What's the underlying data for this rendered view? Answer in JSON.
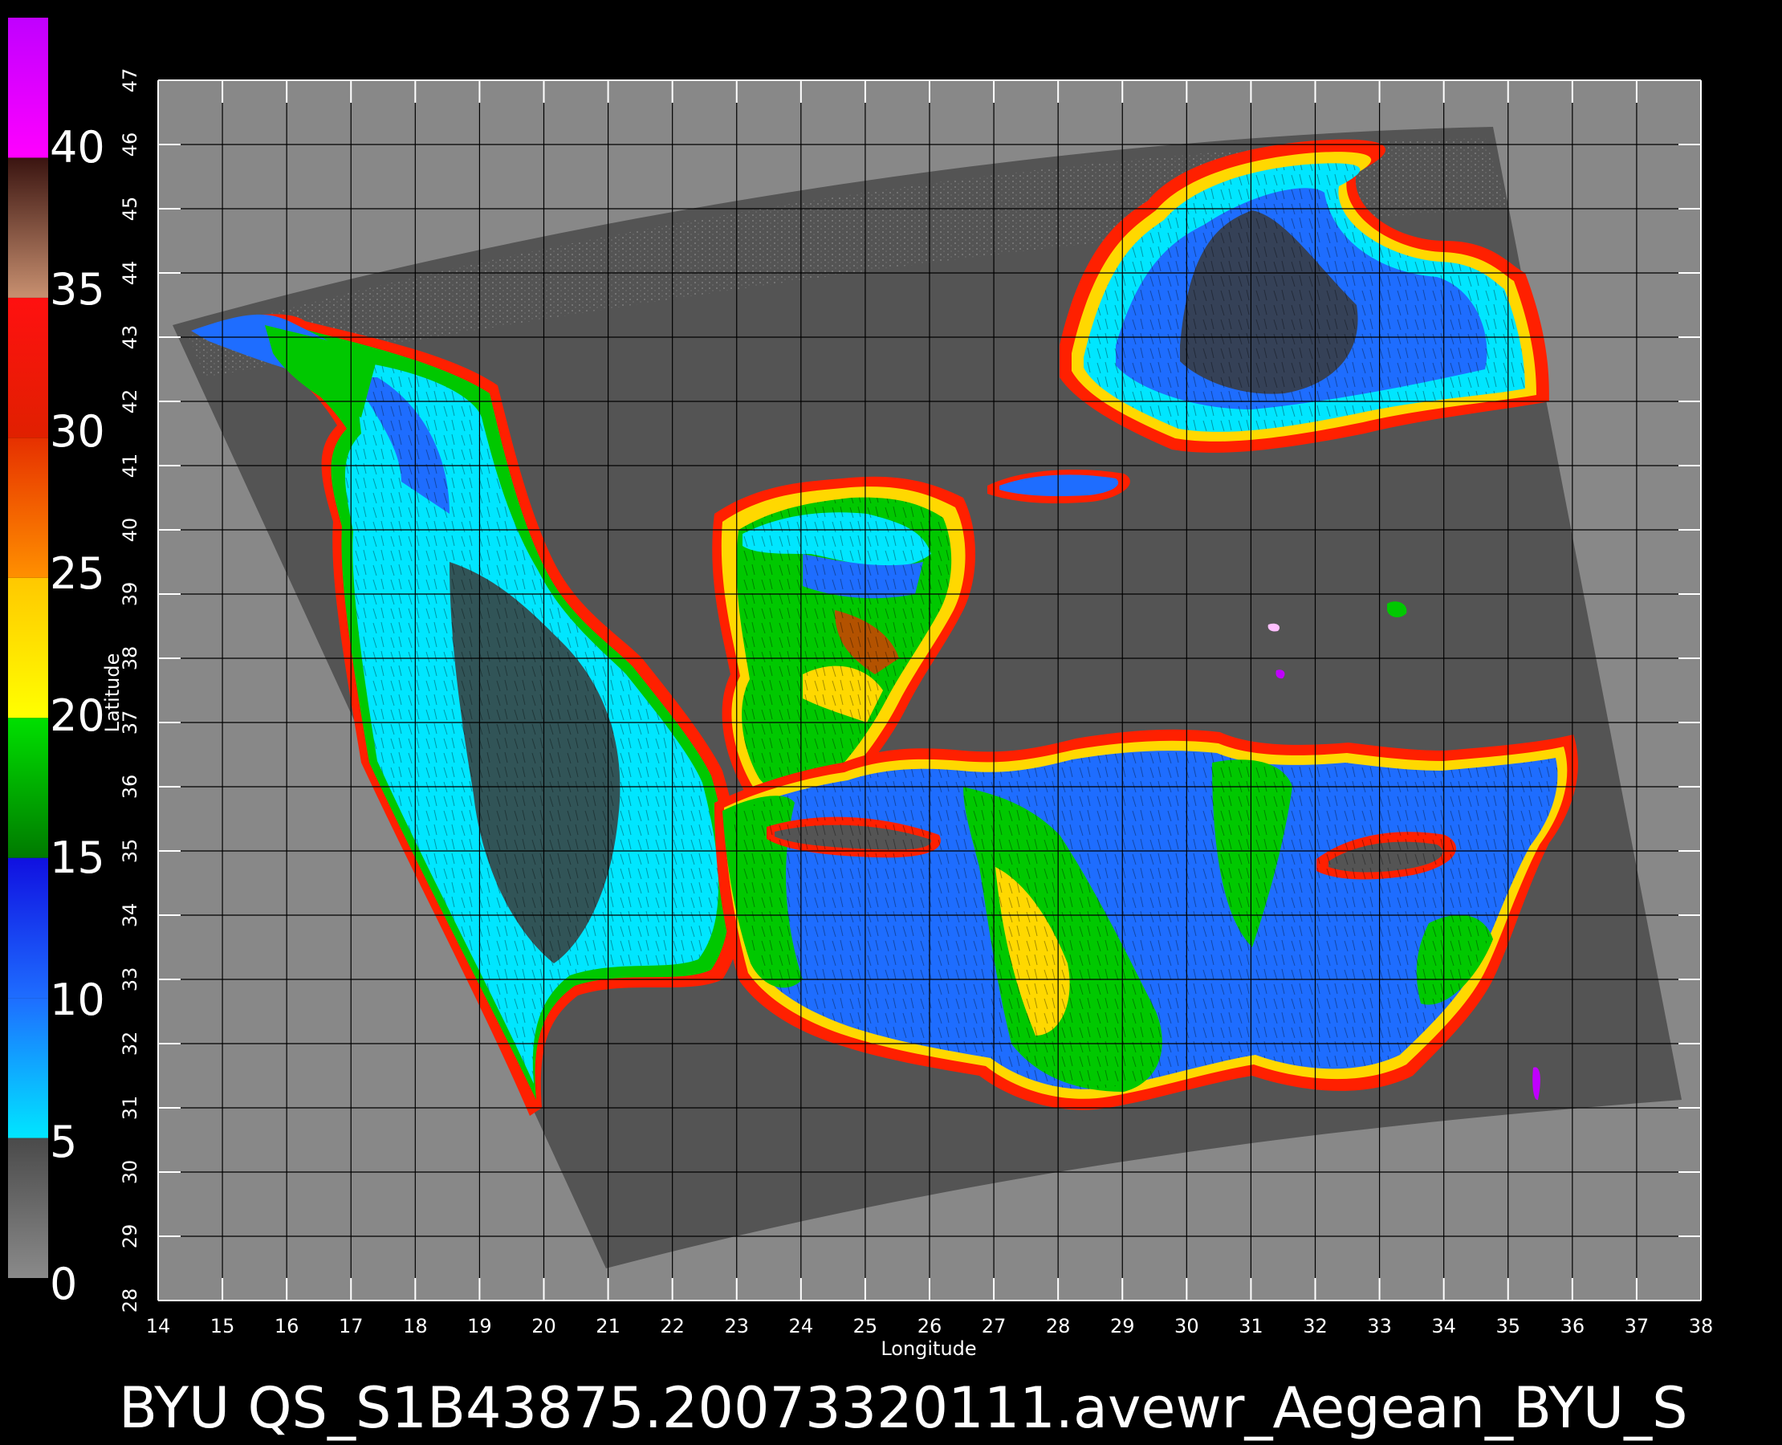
{
  "title": "BYU QS_S1B43875.20073320111.avewr_Aegean_BYU_S",
  "axes": {
    "xlabel": "Longitude",
    "ylabel": "Latitude",
    "xlim": [
      14,
      38
    ],
    "ylim": [
      28,
      47
    ],
    "xticks": [
      "14",
      "15",
      "16",
      "17",
      "18",
      "19",
      "20",
      "21",
      "22",
      "23",
      "24",
      "25",
      "26",
      "27",
      "28",
      "29",
      "30",
      "31",
      "32",
      "33",
      "34",
      "35",
      "36",
      "37",
      "38"
    ],
    "yticks": [
      "28",
      "29",
      "30",
      "31",
      "32",
      "33",
      "34",
      "35",
      "36",
      "37",
      "38",
      "39",
      "40",
      "41",
      "42",
      "43",
      "44",
      "45",
      "46",
      "47"
    ]
  },
  "colorbar": {
    "labels": [
      "0",
      "5",
      "10",
      "15",
      "20",
      "25",
      "30",
      "35",
      "40"
    ],
    "segments": [
      {
        "from": 0,
        "to": 5,
        "top": "#4a4a4a",
        "bottom": "#8a8a8a"
      },
      {
        "from": 5,
        "to": 10,
        "top": "#1e6dff",
        "bottom": "#00e6ff"
      },
      {
        "from": 10,
        "to": 15,
        "top": "#1010e0",
        "bottom": "#1e6dff"
      },
      {
        "from": 15,
        "to": 20,
        "top": "#00e000",
        "bottom": "#007a00"
      },
      {
        "from": 20,
        "to": 25,
        "top": "#ffc800",
        "bottom": "#ffff00"
      },
      {
        "from": 25,
        "to": 30,
        "top": "#e63000",
        "bottom": "#ff9000"
      },
      {
        "from": 30,
        "to": 35,
        "top": "#ff1010",
        "bottom": "#e02000"
      },
      {
        "from": 35,
        "to": 40,
        "top": "#3a1410",
        "bottom": "#c89070"
      },
      {
        "from": 40,
        "to": 45,
        "top": "#c000ff",
        "bottom": "#ff00ff"
      }
    ]
  },
  "colors": {
    "background": "#000000",
    "plot_bg": "#888888",
    "swath": "#545454",
    "grid": "#000000",
    "low": "#00e6ff",
    "mid": "#1010e0",
    "moderate": "#00c800",
    "high": "#ffd800",
    "edge_red": "#ff2000"
  }
}
